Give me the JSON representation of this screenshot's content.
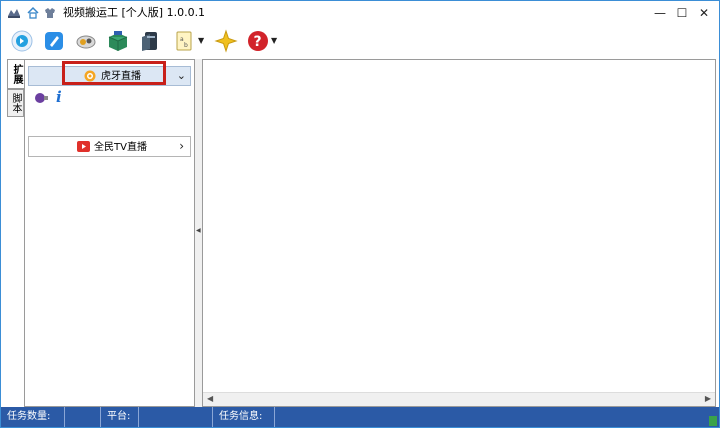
{
  "window": {
    "title": "视频搬运工 [个人版] 1.0.0.1",
    "controls": {
      "minimize": "—",
      "maximize": "☐",
      "close": "✕"
    }
  },
  "titlebar_icons": [
    "app-icon",
    "home-icon",
    "skin-icon"
  ],
  "toolbar": {
    "tools": [
      "refresh-icon",
      "pen-icon",
      "camera-icon",
      "box-icon",
      "file-icon",
      "keyboard-icon",
      "star-icon",
      "help-icon"
    ]
  },
  "side_tabs": {
    "extend": "扩展",
    "script": "脚本"
  },
  "left_panel": {
    "expanded_category": {
      "label": "虎牙直播",
      "chevron": "⌄"
    },
    "info_glyph": "i",
    "collapsed_category": {
      "label": "全民TV直播",
      "chevron": "›"
    }
  },
  "status": {
    "task_count": "任务数量:",
    "platform": "平台:",
    "task_info": "任务信息:"
  },
  "colors": {
    "accent": "#2b5aa6",
    "highlight": "#c8201a",
    "category_bg": "#dce7f4",
    "window_border": "#3b8ed6"
  }
}
